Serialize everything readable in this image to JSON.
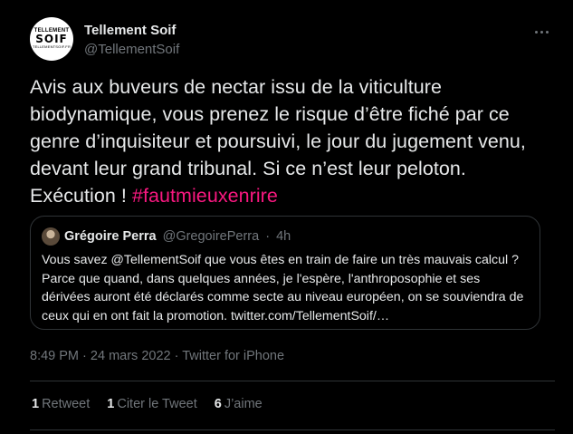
{
  "author": {
    "name": "Tellement Soif",
    "handle": "@TellementSoif",
    "avatar_text": {
      "line1": "TELLEMENT",
      "line2": "SOIF",
      "line3": "TELLEMENTSOIF.FR"
    }
  },
  "tweet": {
    "text": "Avis aux buveurs de nectar issu de la viticulture biodynamique, vous prenez le risque d’être fiché par ce genre d’inquisiteur et poursuivi, le jour du jugement venu, devant leur grand tribunal. Si ce n’est leur peloton. Exécution ! ",
    "hashtag": "#fautmieuxenrire"
  },
  "quote": {
    "name": "Grégoire Perra",
    "handle": "@GregoirePerra",
    "separator": "·",
    "time": "4h",
    "text": "Vous savez @TellementSoif que vous êtes en train de faire un très mauvais calcul ? Parce que quand, dans quelques années, je l'espère, l'anthroposophie et ses dérivées auront été déclarés comme secte au niveau européen, on se souviendra de ceux qui en ont fait la promotion. twitter.com/TellementSoif/…"
  },
  "meta": {
    "time": "8:49 PM",
    "separator": "·",
    "date": "24 mars 2022",
    "source": "Twitter for iPhone"
  },
  "stats": {
    "retweets_count": "1",
    "retweets_label": "Retweet",
    "quotes_count": "1",
    "quotes_label": "Citer le Tweet",
    "likes_count": "6",
    "likes_label": "J’aime"
  },
  "colors": {
    "background": "#000000",
    "text": "#e7e9ea",
    "secondary": "#71767b",
    "hashtag": "#f91880",
    "border": "#2f3336"
  }
}
